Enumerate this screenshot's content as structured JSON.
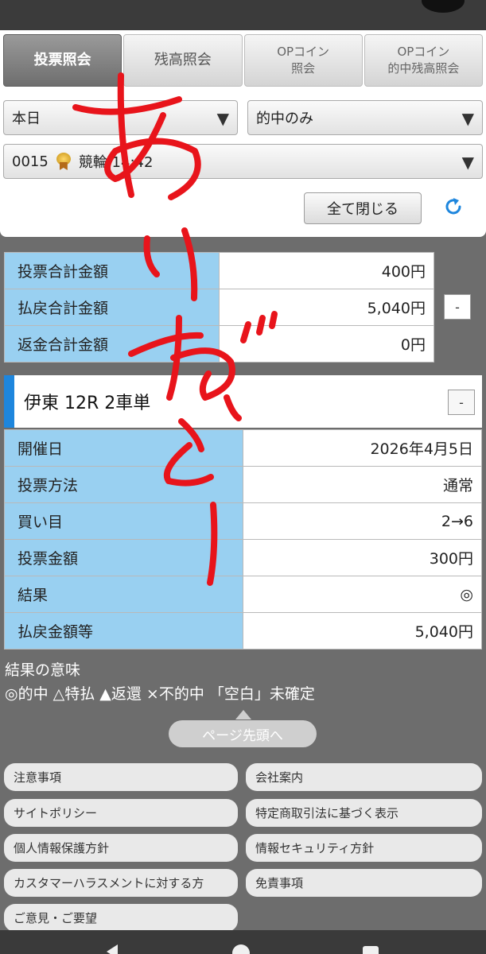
{
  "tabs": [
    {
      "label": "投票照会",
      "active": true
    },
    {
      "label": "残高照会",
      "active": false
    },
    {
      "label": "OPコイン\n照会",
      "active": false
    },
    {
      "label": "OPコイン\n的中残高照会",
      "active": false
    }
  ],
  "filters": {
    "date_value": "本日",
    "result_filter_value": "的中のみ",
    "race_number": "0015",
    "race_label": "競輪 14:42"
  },
  "close_all_label": "全て閉じる",
  "summary": [
    {
      "label": "投票合計金額",
      "value": "400円"
    },
    {
      "label": "払戻合計金額",
      "value": "5,040円"
    },
    {
      "label": "返金合計金額",
      "value": "0円"
    }
  ],
  "collapse_label": "-",
  "race_title": "伊東 12R 2車単",
  "detail": [
    {
      "label": "開催日",
      "value": "2026年4月5日"
    },
    {
      "label": "投票方法",
      "value": "通常"
    },
    {
      "label": "買い目",
      "value": "2→6"
    },
    {
      "label": "投票金額",
      "value": "300円"
    },
    {
      "label": "結果",
      "value": "◎"
    },
    {
      "label": "払戻金額等",
      "value": "5,040円"
    }
  ],
  "legend": {
    "title": "結果の意味",
    "text": "◎的中 △特払 ▲返還 ×不的中 「空白」未確定"
  },
  "page_top_label": "ページ先頭へ",
  "footer_links": [
    "注意事項",
    "会社案内",
    "サイトポリシー",
    "特定商取引法に基づく表示",
    "個人情報保護方針",
    "情報セキュリティ方針",
    "カスタマーハラスメントに対する方",
    "免責事項",
    "ご意見・ご要望"
  ],
  "handwriting": "ありがとー",
  "colors": {
    "accent_blue": "#1e86dd",
    "label_cell": "#99d0f1",
    "background": "#6d6d6d",
    "ink_red": "#e8141b"
  },
  "icons": {
    "dropdown": "triangle-down-icon",
    "refresh": "refresh-icon",
    "medal": "medal-icon"
  }
}
